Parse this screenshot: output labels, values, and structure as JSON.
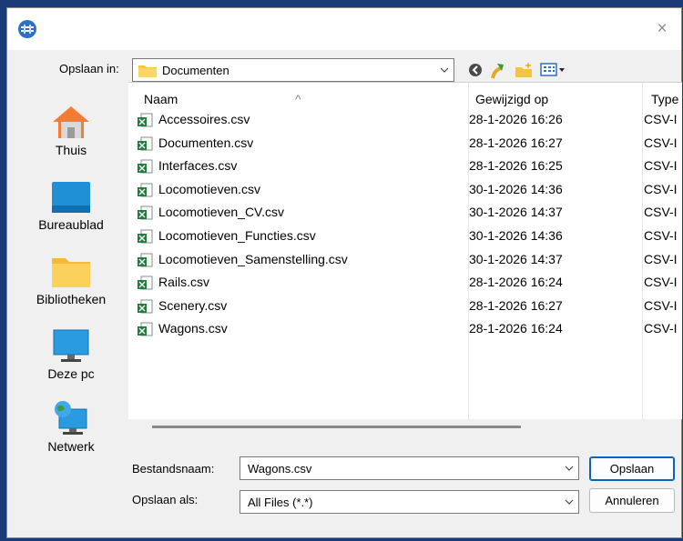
{
  "dialog": {
    "close_glyph": "×"
  },
  "save_in": {
    "label": "Opslaan in:",
    "folder": "Documenten"
  },
  "places": [
    {
      "label": "Thuis",
      "icon": "home-icon"
    },
    {
      "label": "Bureaublad",
      "icon": "desktop-icon"
    },
    {
      "label": "Bibliotheken",
      "icon": "libraries-icon"
    },
    {
      "label": "Deze pc",
      "icon": "this-pc-icon"
    },
    {
      "label": "Netwerk",
      "icon": "network-icon"
    }
  ],
  "columns": {
    "name": "Naam",
    "modified": "Gewijzigd op",
    "type": "Type"
  },
  "files": [
    {
      "name": "Accessoires.csv",
      "modified": "28-1-2026 16:26",
      "type": "CSV-I"
    },
    {
      "name": "Documenten.csv",
      "modified": "28-1-2026 16:27",
      "type": "CSV-I"
    },
    {
      "name": "Interfaces.csv",
      "modified": "28-1-2026 16:25",
      "type": "CSV-I"
    },
    {
      "name": "Locomotieven.csv",
      "modified": "30-1-2026 14:36",
      "type": "CSV-I"
    },
    {
      "name": "Locomotieven_CV.csv",
      "modified": "30-1-2026 14:37",
      "type": "CSV-I"
    },
    {
      "name": "Locomotieven_Functies.csv",
      "modified": "30-1-2026 14:36",
      "type": "CSV-I"
    },
    {
      "name": "Locomotieven_Samenstelling.csv",
      "modified": "30-1-2026 14:37",
      "type": "CSV-I"
    },
    {
      "name": "Rails.csv",
      "modified": "28-1-2026 16:24",
      "type": "CSV-I"
    },
    {
      "name": "Scenery.csv",
      "modified": "28-1-2026 16:27",
      "type": "CSV-I"
    },
    {
      "name": "Wagons.csv",
      "modified": "28-1-2026 16:24",
      "type": "CSV-I"
    }
  ],
  "filename": {
    "label": "Bestandsnaam:",
    "value": "Wagons.csv"
  },
  "filetype": {
    "label": "Opslaan als:",
    "value": "All Files (*.*)"
  },
  "buttons": {
    "save": "Opslaan",
    "cancel": "Annuleren"
  },
  "colors": {
    "accent": "#0067c0",
    "folder": "#f8c542",
    "excel": "#1e7d3a"
  }
}
